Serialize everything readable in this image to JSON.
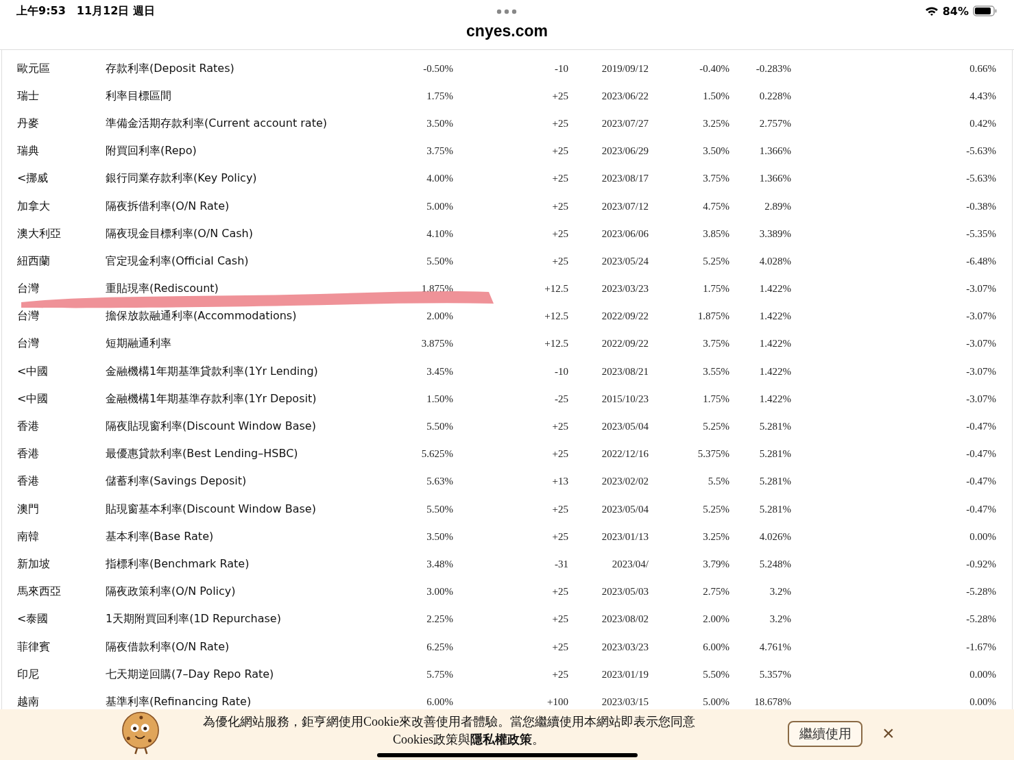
{
  "status_bar": {
    "time": "上午9:53",
    "date": "11月12日 週日",
    "battery": "84%"
  },
  "address_bar": {
    "url": "cnyes.com"
  },
  "table": {
    "rows": [
      [
        "歐元區",
        "存款利率(Deposit Rates)",
        "-0.50%",
        "-10",
        "2019/09/12",
        "-0.40%",
        "-0.283%",
        "0.66%"
      ],
      [
        "瑞士",
        "利率目標區間",
        "1.75%",
        "+25",
        "2023/06/22",
        "1.50%",
        "0.228%",
        "4.43%"
      ],
      [
        "丹麥",
        "準備金活期存款利率(Current account rate)",
        "3.50%",
        "+25",
        "2023/07/27",
        "3.25%",
        "2.757%",
        "0.42%"
      ],
      [
        "瑞典",
        "附買回利率(Repo)",
        "3.75%",
        "+25",
        "2023/06/29",
        "3.50%",
        "1.366%",
        "-5.63%"
      ],
      [
        "<挪威",
        "銀行同業存款利率(Key Policy)",
        "4.00%",
        "+25",
        "2023/08/17",
        "3.75%",
        "1.366%",
        "-5.63%"
      ],
      [
        "加拿大",
        "隔夜拆借利率(O/N Rate)",
        "5.00%",
        "+25",
        "2023/07/12",
        "4.75%",
        "2.89%",
        "-0.38%"
      ],
      [
        "澳大利亞",
        "隔夜現金目標利率(O/N Cash)",
        "4.10%",
        "+25",
        "2023/06/06",
        "3.85%",
        "3.389%",
        "-5.35%"
      ],
      [
        "紐西蘭",
        "官定現金利率(Official Cash)",
        "5.50%",
        "+25",
        "2023/05/24",
        "5.25%",
        "4.028%",
        "-6.48%"
      ],
      [
        "台灣",
        "重貼現率(Rediscount)",
        "1.875%",
        "+12.5",
        "2023/03/23",
        "1.75%",
        "1.422%",
        "-3.07%"
      ],
      [
        "台灣",
        "擔保放款融通利率(Accommodations)",
        "2.00%",
        "+12.5",
        "2022/09/22",
        "1.875%",
        "1.422%",
        "-3.07%"
      ],
      [
        "台灣",
        "短期融通利率",
        "3.875%",
        "+12.5",
        "2022/09/22",
        "3.75%",
        "1.422%",
        "-3.07%"
      ],
      [
        "<中國",
        "金融機構1年期基準貸款利率(1Yr Lending)",
        "3.45%",
        "-10",
        "2023/08/21",
        "3.55%",
        "1.422%",
        "-3.07%"
      ],
      [
        "<中國",
        "金融機構1年期基準存款利率(1Yr Deposit)",
        "1.50%",
        "-25",
        "2015/10/23",
        "1.75%",
        "1.422%",
        "-3.07%"
      ],
      [
        "香港",
        "隔夜貼現窗利率(Discount Window Base)",
        "5.50%",
        "+25",
        "2023/05/04",
        "5.25%",
        "5.281%",
        "-0.47%"
      ],
      [
        "香港",
        "最優惠貸款利率(Best Lending–HSBC)",
        "5.625%",
        "+25",
        "2022/12/16",
        "5.375%",
        "5.281%",
        "-0.47%"
      ],
      [
        "香港",
        "儲蓄利率(Savings Deposit)",
        "5.63%",
        "+13",
        "2023/02/02",
        "5.5%",
        "5.281%",
        "-0.47%"
      ],
      [
        "澳門",
        "貼現窗基本利率(Discount Window Base)",
        "5.50%",
        "+25",
        "2023/05/04",
        "5.25%",
        "5.281%",
        "-0.47%"
      ],
      [
        "南韓",
        "基本利率(Base Rate)",
        "3.50%",
        "+25",
        "2023/01/13",
        "3.25%",
        "4.026%",
        "0.00%"
      ],
      [
        "新加坡",
        "指標利率(Benchmark Rate)",
        "3.48%",
        "-31",
        "2023/04/",
        "3.79%",
        "5.248%",
        "-0.92%"
      ],
      [
        "馬來西亞",
        "隔夜政策利率(O/N Policy)",
        "3.00%",
        "+25",
        "2023/05/03",
        "2.75%",
        "3.2%",
        "-5.28%"
      ],
      [
        "<泰國",
        "1天期附買回利率(1D Repurchase)",
        "2.25%",
        "+25",
        "2023/08/02",
        "2.00%",
        "3.2%",
        "-5.28%"
      ],
      [
        "菲律賓",
        "隔夜借款利率(O/N Rate)",
        "6.25%",
        "+25",
        "2023/03/23",
        "6.00%",
        "4.761%",
        "-1.67%"
      ],
      [
        "印尼",
        "七天期逆回購(7–Day Repo Rate)",
        "5.75%",
        "+25",
        "2023/01/19",
        "5.50%",
        "5.357%",
        "0.00%"
      ],
      [
        "越南",
        "基準利率(Refinancing Rate)",
        "6.00%",
        "+100",
        "2023/03/15",
        "5.00%",
        "18.678%",
        "0.00%"
      ]
    ]
  },
  "cookie_banner": {
    "message": "為優化網站服務，鉅亨網使用Cookie來改善使用者體驗。當您繼續使用本網站即表示您同意",
    "policy": "Cookies政策與**隱私權政策**。",
    "button": "繼續使用",
    "close": "×"
  }
}
